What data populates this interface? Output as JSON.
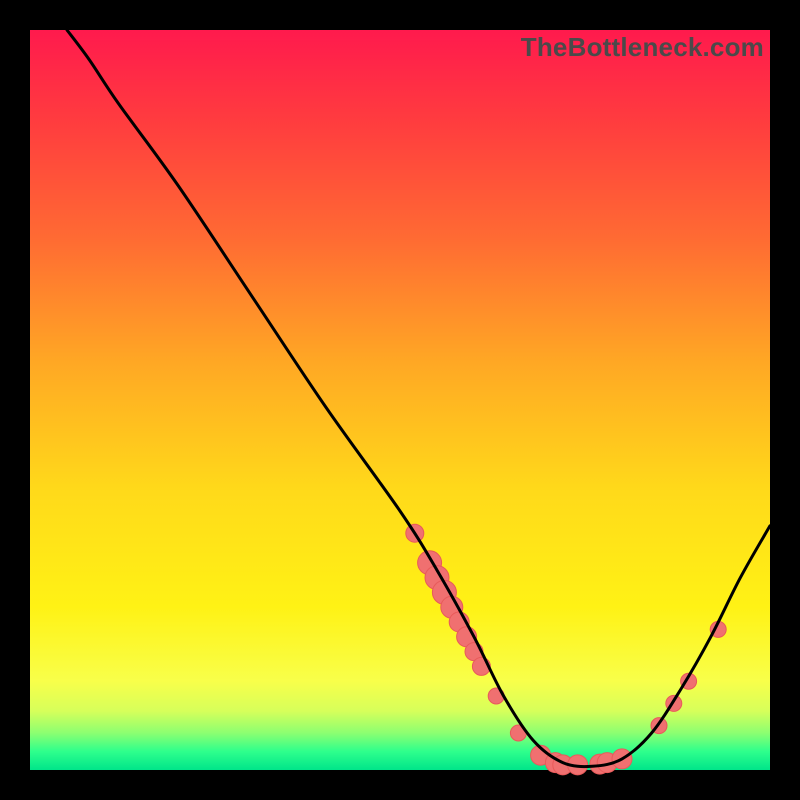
{
  "watermark": "TheBottleneck.com",
  "colors": {
    "curve": "#000000",
    "marker_fill": "#f07070",
    "marker_stroke": "#e85a5a",
    "background_black": "#000000",
    "gradient_top": "#ff1a4d",
    "gradient_bottom": "#00e58a"
  },
  "chart_data": {
    "type": "line",
    "title": "",
    "xlabel": "",
    "ylabel": "",
    "xlim": [
      0,
      100
    ],
    "ylim": [
      0,
      100
    ],
    "curve": [
      {
        "x": 5,
        "y": 100
      },
      {
        "x": 8,
        "y": 96
      },
      {
        "x": 12,
        "y": 90
      },
      {
        "x": 20,
        "y": 79
      },
      {
        "x": 30,
        "y": 64
      },
      {
        "x": 40,
        "y": 49
      },
      {
        "x": 50,
        "y": 35
      },
      {
        "x": 55,
        "y": 27
      },
      {
        "x": 60,
        "y": 18
      },
      {
        "x": 64,
        "y": 10
      },
      {
        "x": 68,
        "y": 4
      },
      {
        "x": 72,
        "y": 1
      },
      {
        "x": 76,
        "y": 0.5
      },
      {
        "x": 80,
        "y": 1.5
      },
      {
        "x": 84,
        "y": 5
      },
      {
        "x": 88,
        "y": 11
      },
      {
        "x": 92,
        "y": 18
      },
      {
        "x": 96,
        "y": 26
      },
      {
        "x": 100,
        "y": 33
      }
    ],
    "markers": [
      {
        "x": 52,
        "y": 32,
        "r": 9
      },
      {
        "x": 54,
        "y": 28,
        "r": 12
      },
      {
        "x": 55,
        "y": 26,
        "r": 12
      },
      {
        "x": 56,
        "y": 24,
        "r": 12
      },
      {
        "x": 57,
        "y": 22,
        "r": 11
      },
      {
        "x": 58,
        "y": 20,
        "r": 10
      },
      {
        "x": 59,
        "y": 18,
        "r": 10
      },
      {
        "x": 60,
        "y": 16,
        "r": 9
      },
      {
        "x": 61,
        "y": 14,
        "r": 9
      },
      {
        "x": 63,
        "y": 10,
        "r": 8
      },
      {
        "x": 66,
        "y": 5,
        "r": 8
      },
      {
        "x": 69,
        "y": 2,
        "r": 10
      },
      {
        "x": 71,
        "y": 1,
        "r": 10
      },
      {
        "x": 72,
        "y": 0.7,
        "r": 10
      },
      {
        "x": 74,
        "y": 0.7,
        "r": 10
      },
      {
        "x": 77,
        "y": 0.8,
        "r": 10
      },
      {
        "x": 78,
        "y": 1,
        "r": 10
      },
      {
        "x": 80,
        "y": 1.5,
        "r": 10
      },
      {
        "x": 85,
        "y": 6,
        "r": 8
      },
      {
        "x": 87,
        "y": 9,
        "r": 8
      },
      {
        "x": 89,
        "y": 12,
        "r": 8
      },
      {
        "x": 93,
        "y": 19,
        "r": 8
      }
    ]
  }
}
